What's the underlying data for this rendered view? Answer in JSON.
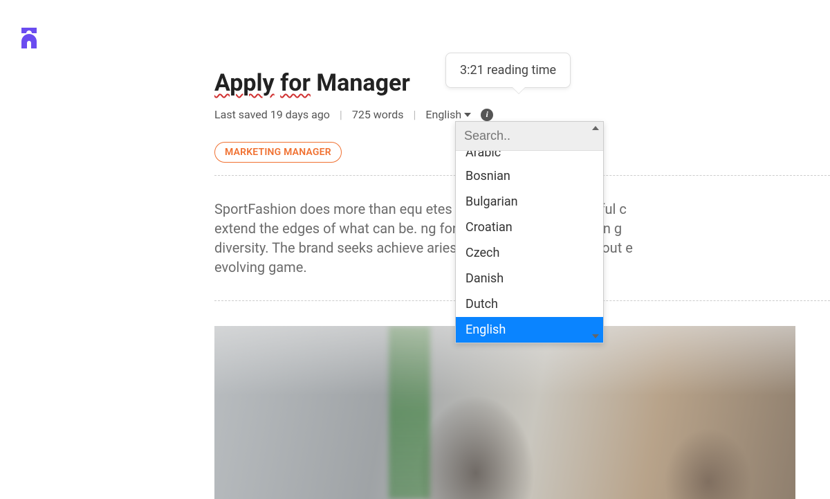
{
  "title": {
    "w1": "Apply",
    "w2": "for",
    "w3": "Manager"
  },
  "meta": {
    "last_saved": "Last saved 19 days ago",
    "word_count": "725 words",
    "language_current": "English",
    "info_glyph": "i"
  },
  "tooltip": {
    "text": "3:21 reading time"
  },
  "tags": {
    "items": [
      "MARKETING MANAGER"
    ]
  },
  "body": "SportFashion does more than equ                                         etes with best-in-class, colorful c\nextend the edges of what can be.                                      ng for game changers who can g\ndiversity. The brand seeks achieve                                    aries. At SportFashion it's about e\nevolving game.",
  "dropdown": {
    "search_placeholder": "Search..",
    "options": [
      "Arabic",
      "Bosnian",
      "Bulgarian",
      "Croatian",
      "Czech",
      "Danish",
      "Dutch",
      "English"
    ],
    "selected_index": 7
  }
}
